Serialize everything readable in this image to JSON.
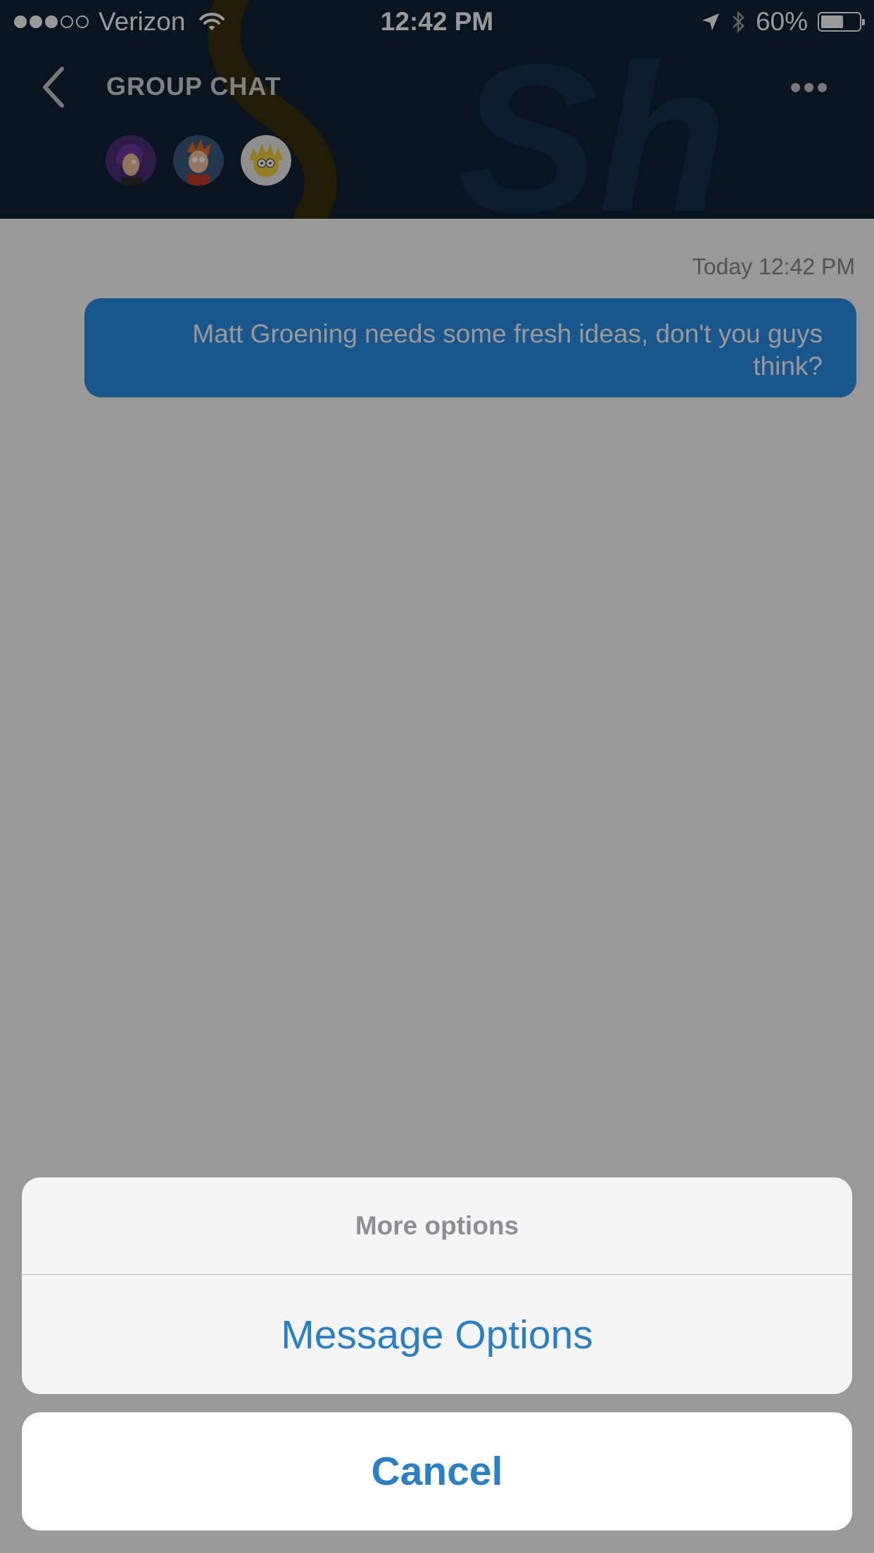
{
  "status_bar": {
    "carrier": "Verizon",
    "time": "12:42 PM",
    "battery_percent": "60%",
    "battery_level": 0.6,
    "signal_bars": 3,
    "signal_max": 5,
    "icons": [
      "wifi-icon",
      "location-arrow-icon",
      "bluetooth-icon",
      "battery-icon"
    ]
  },
  "header": {
    "title": "GROUP CHAT",
    "back_icon": "chevron-left-icon",
    "more_icon": "ellipsis-icon",
    "avatars": [
      "avatar-purple-hair",
      "avatar-orange-hair",
      "avatar-yellow-spiky"
    ]
  },
  "chat": {
    "timestamp": "Today 12:42 PM",
    "messages": [
      {
        "text": "Matt Groening needs some fresh ideas, don't you guys think?",
        "outgoing": true
      }
    ]
  },
  "action_sheet": {
    "title": "More options",
    "actions": [
      "Message Options"
    ],
    "cancel_label": "Cancel"
  },
  "colors": {
    "accent": "#2c7fc4",
    "bubble": "#2a8fe8",
    "header_bg": "#0e2236"
  }
}
